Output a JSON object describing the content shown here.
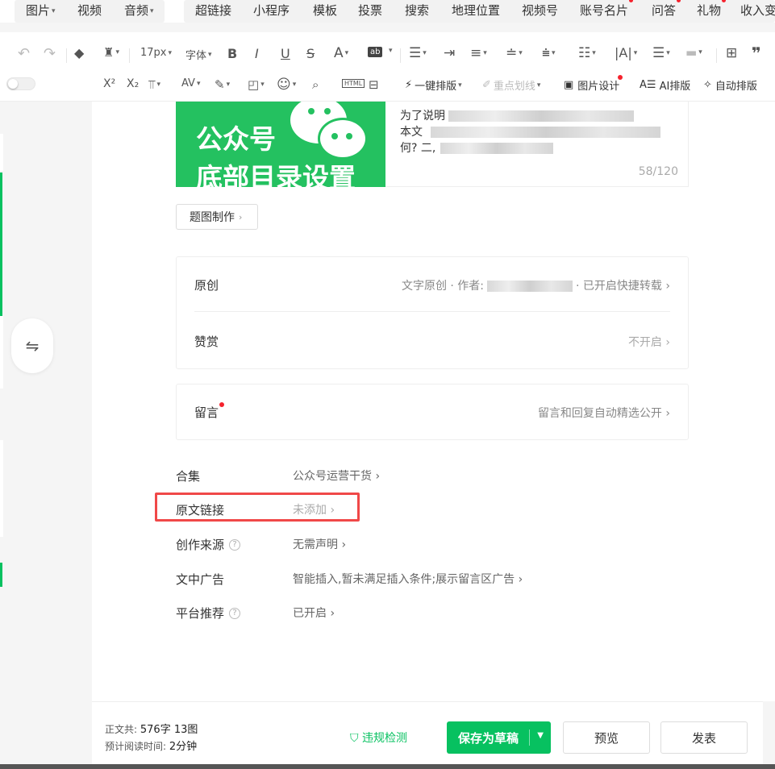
{
  "top_menu": {
    "items": [
      {
        "label": "图片",
        "caret": true
      },
      {
        "label": "视频",
        "caret": false
      },
      {
        "label": "音频",
        "caret": true
      },
      {
        "label": "超链接"
      },
      {
        "label": "小程序"
      },
      {
        "label": "模板"
      },
      {
        "label": "投票"
      },
      {
        "label": "搜索"
      },
      {
        "label": "地理位置"
      },
      {
        "label": "视频号"
      },
      {
        "label": "账号名片"
      },
      {
        "label": "问答"
      },
      {
        "label": "礼物"
      },
      {
        "label": "收入变"
      }
    ]
  },
  "toolbar": {
    "font_size": "17px",
    "font_family": "字体",
    "one_click_layout": "一键排版",
    "key_underline": "重点划线",
    "image_design": "图片设计",
    "ai_layout": "AI排版",
    "auto_layout": "自动排版"
  },
  "cover": {
    "line1": "公众号",
    "line2": "底部目录设置"
  },
  "summary": {
    "line1_visible": "为了说明",
    "line2_visible": "本文",
    "line3_visible": "何? 二,",
    "count": "58/120"
  },
  "make_title_button": "题图制作",
  "card_original": {
    "original_label": "原创",
    "original_value_prefix": "文字原创 · 作者:",
    "original_value_suffix": "· 已开启快捷转载",
    "reward_label": "赞赏",
    "reward_value": "不开启"
  },
  "card_comment": {
    "label": "留言",
    "value": "留言和回复自动精选公开"
  },
  "settings": {
    "collection_label": "合集",
    "collection_value": "公众号运营干货",
    "source_link_label": "原文链接",
    "source_link_value": "未添加",
    "creation_source_label": "创作来源",
    "creation_source_value": "无需声明",
    "in_article_ad_label": "文中广告",
    "in_article_ad_value": "智能插入,暂未满足插入条件;展示留言区广告",
    "platform_recommend_label": "平台推荐",
    "platform_recommend_value": "已开启"
  },
  "bottom": {
    "body_count_label": "正文共:",
    "body_count_value": "576字 13图",
    "read_time_label": "预计阅读时间:",
    "read_time_value": "2分钟",
    "violation_check": "违规检测",
    "save_draft": "保存为草稿",
    "preview": "预览",
    "publish": "发表"
  },
  "colors": {
    "brand_green": "#07c160",
    "highlight_red": "#f04848",
    "badge_red": "#f5222d"
  }
}
